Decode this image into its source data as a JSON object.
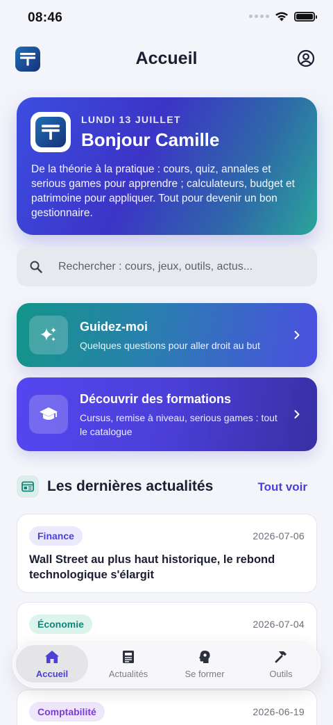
{
  "status_bar": {
    "time": "08:46"
  },
  "header": {
    "title": "Accueil"
  },
  "hero": {
    "date": "LUNDI 13 JUILLET",
    "greeting": "Bonjour Camille",
    "description": "De la théorie à la pratique : cours, quiz, annales et serious games pour apprendre ; calculateurs, budget et patrimoine pour appliquer. Tout pour devenir un bon gestionnaire."
  },
  "search": {
    "placeholder": "Rechercher : cours, jeux, outils, actus..."
  },
  "cards": {
    "guide": {
      "title": "Guidez-moi",
      "subtitle": "Quelques questions pour aller droit au but",
      "icon": "sparkles-icon"
    },
    "formations": {
      "title": "Découvrir des formations",
      "subtitle": "Cursus, remise à niveau, serious games : tout le catalogue",
      "icon": "graduation-cap-icon"
    }
  },
  "news": {
    "title": "Les dernières actualités",
    "see_all": "Tout voir",
    "items": [
      {
        "tag": "Finance",
        "date": "2026-07-06",
        "headline": "Wall Street au plus haut historique, le rebond technologique s'élargit"
      },
      {
        "tag": "Économie",
        "date": "2026-07-04",
        "headline": ""
      },
      {
        "tag": "Comptabilité",
        "date": "2026-06-19",
        "headline": ""
      }
    ]
  },
  "tabs": [
    {
      "label": "Accueil",
      "icon": "home-icon",
      "active": true
    },
    {
      "label": "Actualités",
      "icon": "newspaper-icon",
      "active": false
    },
    {
      "label": "Se former",
      "icon": "brain-head-icon",
      "active": false
    },
    {
      "label": "Outils",
      "icon": "hammer-icon",
      "active": false
    }
  ],
  "colors": {
    "accent": "#4a3fd8",
    "teal": "#139488",
    "background": "#f4f5fa"
  }
}
